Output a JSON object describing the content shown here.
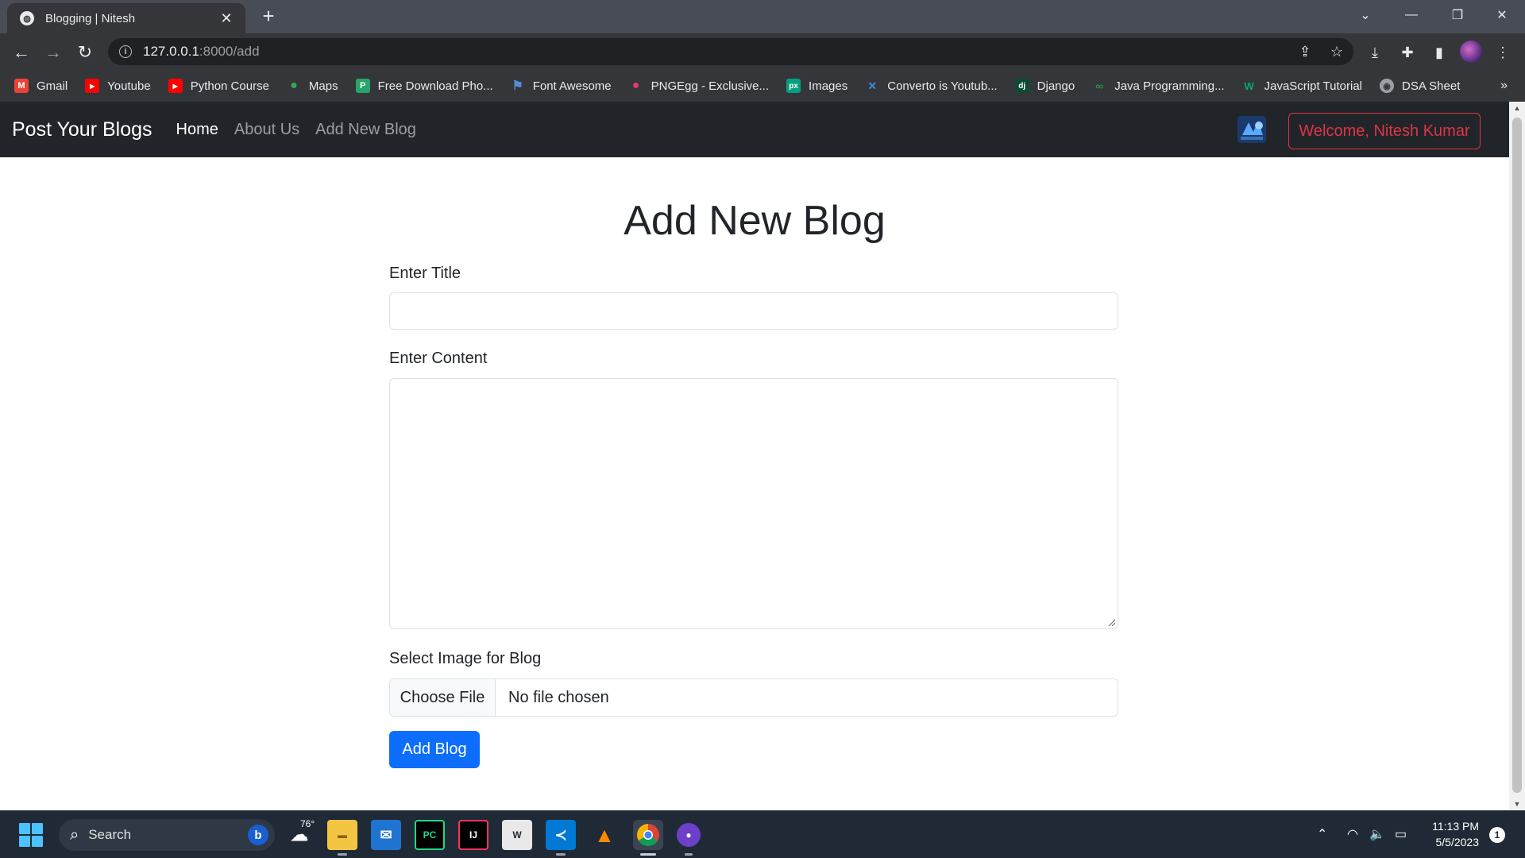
{
  "browser": {
    "tab_title": "Blogging | Nitesh",
    "tab_favicon": "globe-icon",
    "new_tab_symbol": "+",
    "url_host": "127.0.0.1",
    "url_path": ":8000/add",
    "bookmarks": [
      {
        "label": "Gmail",
        "icon": "gmail-icon",
        "color": "#ea4335",
        "glyph": "M"
      },
      {
        "label": "Youtube",
        "icon": "youtube-icon",
        "color": "#ff0000",
        "glyph": "▶"
      },
      {
        "label": "Python Course",
        "icon": "youtube-icon",
        "color": "#ff0000",
        "glyph": "▶"
      },
      {
        "label": "Maps",
        "icon": "maps-pin-icon",
        "color": "#34a853",
        "glyph": "●"
      },
      {
        "label": "Free Download Pho...",
        "icon": "photo-site-icon",
        "color": "#25a56a",
        "glyph": "P"
      },
      {
        "label": "Font Awesome",
        "icon": "flag-icon",
        "color": "#538dd7",
        "glyph": "⚑"
      },
      {
        "label": "PNGEgg - Exclusive...",
        "icon": "egg-icon",
        "color": "#e9357c",
        "glyph": "●"
      },
      {
        "label": "Images",
        "icon": "pexels-icon",
        "color": "#05a081",
        "glyph": "px"
      },
      {
        "label": "Converto is Youtub...",
        "icon": "converto-icon",
        "color": "#3d8bd8",
        "glyph": "✕"
      },
      {
        "label": "Django",
        "icon": "django-icon",
        "color": "#0c4b33",
        "glyph": "dj"
      },
      {
        "label": "Java Programming...",
        "icon": "geeks-icon",
        "color": "#2f8d46",
        "glyph": "∞"
      },
      {
        "label": "JavaScript Tutorial",
        "icon": "w3-icon",
        "color": "#04aa6d",
        "glyph": "W"
      },
      {
        "label": "DSA Sheet",
        "icon": "globe-icon",
        "color": "#5f6368",
        "glyph": "◉"
      }
    ],
    "more_bookmarks": "»"
  },
  "site": {
    "brand": "Post Your Blogs",
    "nav": [
      {
        "label": "Home",
        "active": true
      },
      {
        "label": "About Us",
        "active": false
      },
      {
        "label": "Add New Blog",
        "active": false
      }
    ],
    "welcome": "Welcome, Nitesh Kumar"
  },
  "form": {
    "heading": "Add New Blog",
    "title_label": "Enter Title",
    "title_value": "",
    "content_label": "Enter Content",
    "content_value": "",
    "image_label": "Select Image for Blog",
    "choose_file": "Choose File",
    "no_file": "No file chosen",
    "submit": "Add Blog"
  },
  "taskbar": {
    "search_placeholder": "Search",
    "weather_temp": "76°",
    "clock_time": "11:13 PM",
    "clock_date": "5/5/2023",
    "notification_count": "1"
  },
  "colors": {
    "navbar_bg": "#212529",
    "primary": "#0d6efd",
    "danger": "#dc3545",
    "chrome_dark": "#35363a"
  }
}
